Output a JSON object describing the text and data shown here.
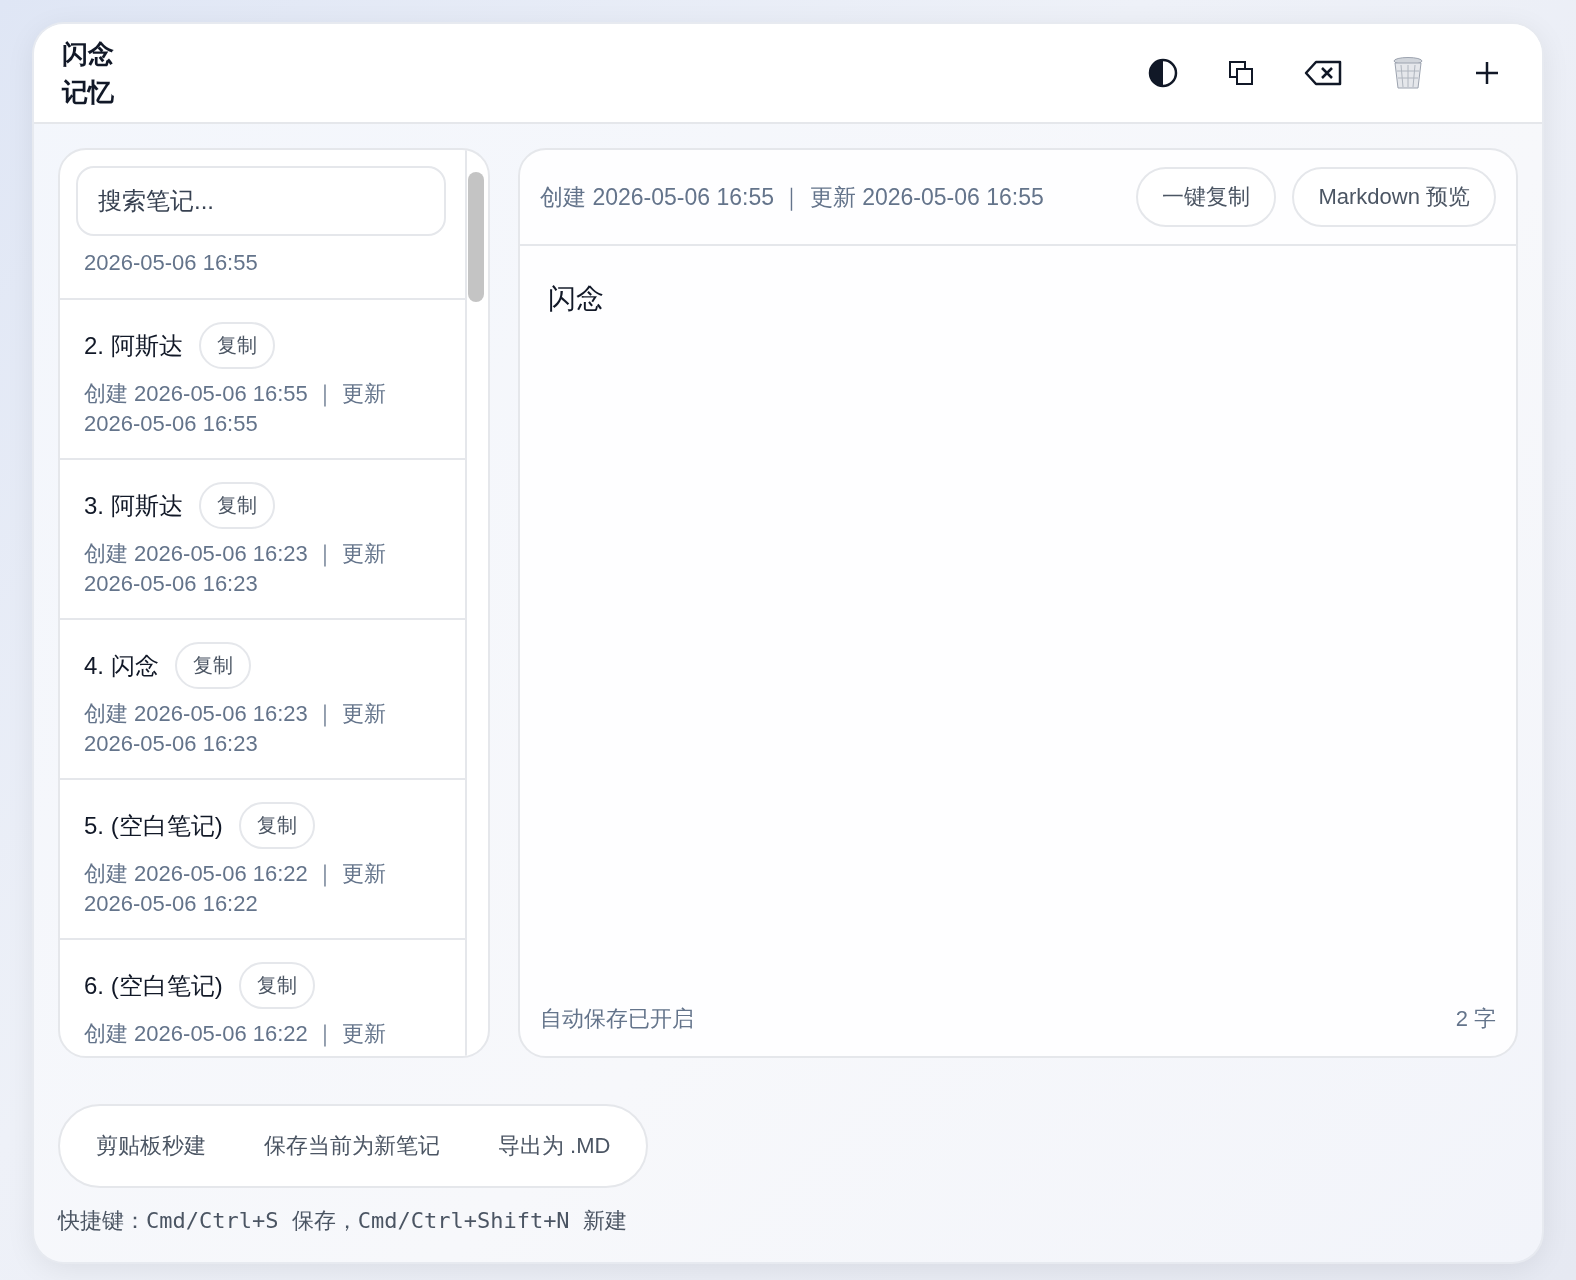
{
  "app": {
    "title": "闪念记忆"
  },
  "search": {
    "placeholder": "搜索笔记..."
  },
  "notes": [
    {
      "kind": "partial",
      "meta": "2026-05-06 16:55"
    },
    {
      "kind": "full",
      "title": "2. 阿斯达",
      "copy": "复制",
      "meta": "创建 2026-05-06 16:55 ｜ 更新 2026-05-06 16:55"
    },
    {
      "kind": "full",
      "title": "3. 阿斯达",
      "copy": "复制",
      "meta": "创建 2026-05-06 16:23 ｜ 更新 2026-05-06 16:23"
    },
    {
      "kind": "full",
      "title": "4. 闪念",
      "copy": "复制",
      "meta": "创建 2026-05-06 16:23 ｜ 更新 2026-05-06 16:23"
    },
    {
      "kind": "full",
      "title": "5. (空白笔记)",
      "copy": "复制",
      "meta": "创建 2026-05-06 16:22 ｜ 更新 2026-05-06 16:22"
    },
    {
      "kind": "full",
      "title": "6. (空白笔记)",
      "copy": "复制",
      "meta": "创建 2026-05-06 16:22 ｜ 更新"
    }
  ],
  "editor": {
    "meta": "创建 2026-05-06 16:55 ｜ 更新 2026-05-06 16:55",
    "buttons": [
      "一键复制",
      "Markdown 预览"
    ],
    "content": "闪念",
    "status": "自动保存已开启",
    "count": "2 字"
  },
  "actions": [
    "剪贴板秒建",
    "保存当前为新笔记",
    "导出为 .MD"
  ],
  "shortcut_hint": "快捷键：Cmd/Ctrl+S 保存，Cmd/Ctrl+Shift+N 新建"
}
